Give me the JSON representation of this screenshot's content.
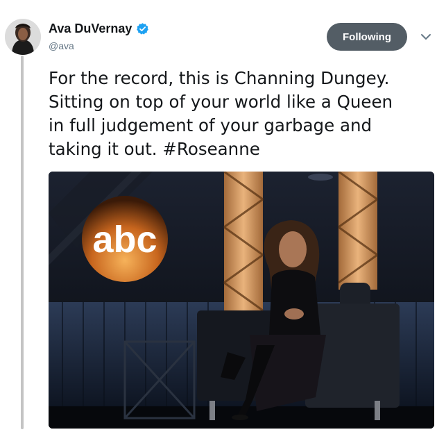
{
  "tweet": {
    "author": {
      "name": "Ava DuVernay",
      "handle": "@ava",
      "verified": true
    },
    "follow_button_label": "Following",
    "text_lines": [
      "For the record, this is Channing Dungey.",
      "Sitting on top of your world like a Queen",
      "in full judgement of your garbage and",
      "taking it out. #Roseanne"
    ],
    "media": {
      "logo_text": "abc"
    }
  },
  "colors": {
    "text": "#14171a",
    "secondary_text": "#657786",
    "following_button": "#535d65",
    "verified_badge": "#1da1f2",
    "thread_line": "#c4c4c4"
  },
  "icons": {
    "verified": "verified-badge-icon",
    "caret": "chevron-down-icon"
  }
}
